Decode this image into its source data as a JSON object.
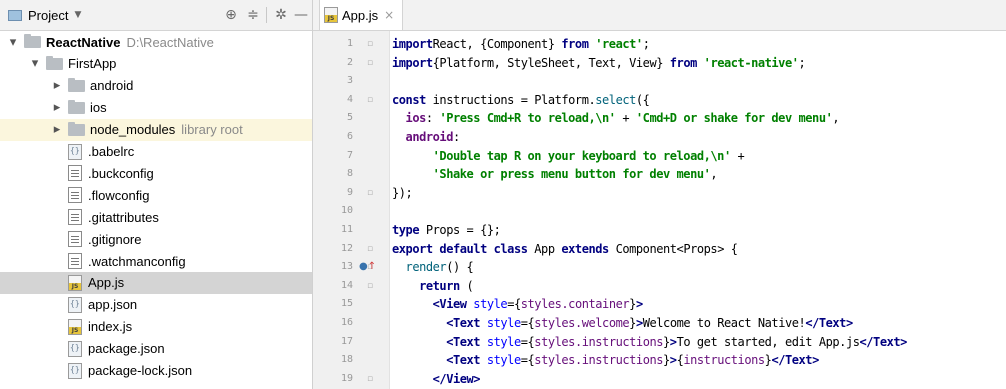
{
  "project_panel": {
    "title": "Project",
    "tree": [
      {
        "label": "ReactNative",
        "extra": "D:\\ReactNative",
        "type": "folder",
        "depth": 0,
        "expanded": true
      },
      {
        "label": "FirstApp",
        "type": "folder",
        "depth": 1,
        "expanded": true
      },
      {
        "label": "android",
        "type": "folder",
        "depth": 2,
        "expanded": false
      },
      {
        "label": "ios",
        "type": "folder",
        "depth": 2,
        "expanded": false
      },
      {
        "label": "node_modules",
        "extra": "library root",
        "type": "folder",
        "depth": 2,
        "expanded": false
      },
      {
        "label": ".babelrc",
        "type": "json",
        "depth": 2
      },
      {
        "label": ".buckconfig",
        "type": "text",
        "depth": 2
      },
      {
        "label": ".flowconfig",
        "type": "text",
        "depth": 2
      },
      {
        "label": ".gitattributes",
        "type": "text",
        "depth": 2
      },
      {
        "label": ".gitignore",
        "type": "text",
        "depth": 2
      },
      {
        "label": ".watchmanconfig",
        "type": "text",
        "depth": 2
      },
      {
        "label": "App.js",
        "type": "js",
        "depth": 2,
        "selected": true
      },
      {
        "label": "app.json",
        "type": "json",
        "depth": 2
      },
      {
        "label": "index.js",
        "type": "js",
        "depth": 2
      },
      {
        "label": "package.json",
        "type": "json",
        "depth": 2
      },
      {
        "label": "package-lock.json",
        "type": "json",
        "depth": 2
      }
    ]
  },
  "editor": {
    "tab_label": "App.js",
    "tab_close": "×",
    "line_numbers": [
      "1",
      "2",
      "3",
      "4",
      "5",
      "6",
      "7",
      "8",
      "9",
      "10",
      "11",
      "12",
      "13",
      "14",
      "15",
      "16",
      "17",
      "18",
      "19"
    ],
    "lines": [
      [
        [
          "kw",
          "import"
        ],
        [
          "",
          "React, {Component} "
        ],
        [
          "kw",
          "from"
        ],
        [
          "",
          ""
        ],
        [
          "str",
          " 'react'"
        ],
        [
          "",
          ";"
        ]
      ],
      [
        [
          "kw",
          "import"
        ],
        [
          "",
          "{Platform, StyleSheet, Text, View} "
        ],
        [
          "kw",
          "from"
        ],
        [
          "str",
          " 'react-native'"
        ],
        [
          "",
          ";"
        ]
      ],
      [],
      [
        [
          "kw",
          "const"
        ],
        [
          "",
          " instructions = Platform."
        ],
        [
          "fn",
          "select"
        ],
        [
          "",
          "({"
        ]
      ],
      [
        [
          "",
          ""
        ],
        [
          "prop",
          "  ios"
        ],
        [
          "",
          ": "
        ],
        [
          "str",
          "'Press Cmd+R to reload,\\n'"
        ],
        [
          "",
          " + "
        ],
        [
          "str",
          "'Cmd+D or shake for dev menu'"
        ],
        [
          "",
          ","
        ]
      ],
      [
        [
          "prop",
          "  android"
        ],
        [
          "",
          ":"
        ]
      ],
      [
        [
          "",
          ""
        ],
        [
          "str",
          "      'Double tap R on your keyboard to reload,\\n'"
        ],
        [
          "",
          " +"
        ]
      ],
      [
        [
          "str",
          "      'Shake or press menu button for dev menu'"
        ],
        [
          "",
          ","
        ]
      ],
      [
        [
          "",
          "});"
        ]
      ],
      [],
      [
        [
          "kw",
          "type"
        ],
        [
          "",
          " Props = {};"
        ]
      ],
      [
        [
          "kw",
          "export default class"
        ],
        [
          "",
          " App "
        ],
        [
          "kw",
          "extends"
        ],
        [
          "",
          " Component<Props> {"
        ]
      ],
      [
        [
          "fn",
          "  render"
        ],
        [
          "",
          "() {"
        ]
      ],
      [
        [
          "kw",
          "    return"
        ],
        [
          "",
          " ("
        ]
      ],
      [
        [
          "",
          ""
        ],
        [
          "tag",
          "      <View"
        ],
        [
          "attr",
          " style"
        ],
        [
          "",
          "={"
        ],
        [
          "field",
          "styles.container"
        ],
        [
          "",
          "}"
        ],
        [
          "tag",
          ">"
        ]
      ],
      [
        [
          "tag",
          "        <Text"
        ],
        [
          "attr",
          " style"
        ],
        [
          "",
          "={"
        ],
        [
          "field",
          "styles.welcome"
        ],
        [
          "",
          "}"
        ],
        [
          "tag",
          ">"
        ],
        [
          "",
          "Welcome to React Native!"
        ],
        [
          "tag",
          "</Text>"
        ]
      ],
      [
        [
          "tag",
          "        <Text"
        ],
        [
          "attr",
          " style"
        ],
        [
          "",
          "={"
        ],
        [
          "field",
          "styles.instructions"
        ],
        [
          "",
          "}"
        ],
        [
          "tag",
          ">"
        ],
        [
          "",
          "To get started, edit App.js"
        ],
        [
          "tag",
          "</Text>"
        ]
      ],
      [
        [
          "tag",
          "        <Text"
        ],
        [
          "attr",
          " style"
        ],
        [
          "",
          "={"
        ],
        [
          "field",
          "styles.instructions"
        ],
        [
          "",
          "}"
        ],
        [
          "tag",
          ">"
        ],
        [
          "",
          "{"
        ],
        [
          "field",
          "instructions"
        ],
        [
          "",
          "}"
        ],
        [
          "tag",
          "</Text>"
        ]
      ],
      [
        [
          "tag",
          "      </View>"
        ]
      ]
    ]
  },
  "colors": {
    "selection": "#d4d4d4",
    "library_root": "#fbf6dd",
    "keyword": "#000080",
    "string": "#008000"
  },
  "icons": [
    "settings-icon",
    "collapse-all-icon",
    "gear-icon",
    "hide-icon",
    "override-method-icon"
  ]
}
